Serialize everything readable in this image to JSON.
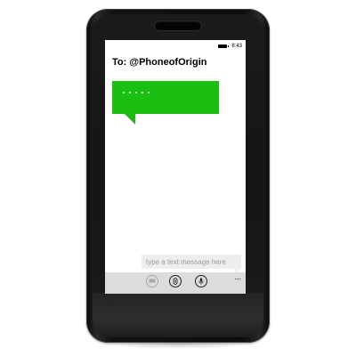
{
  "status_bar": {
    "time": "8:43",
    "battery_icon": "battery-icon"
  },
  "conversation": {
    "recipient_prefix": "To:",
    "recipient": "@PhoneofOrigin",
    "messages": [
      {
        "text": ".....",
        "color": "#1bbf12"
      }
    ]
  },
  "composer": {
    "placeholder": "type a text message here"
  },
  "app_bar": {
    "buttons": [
      {
        "icon": "send-icon",
        "enabled": false
      },
      {
        "icon": "attach-icon",
        "enabled": true
      },
      {
        "icon": "microphone-icon",
        "enabled": true
      }
    ],
    "more": "..."
  },
  "colors": {
    "accent": "#1bbf12",
    "app_bar": "#dcdcdc",
    "composer_bg": "#eeeeee"
  }
}
